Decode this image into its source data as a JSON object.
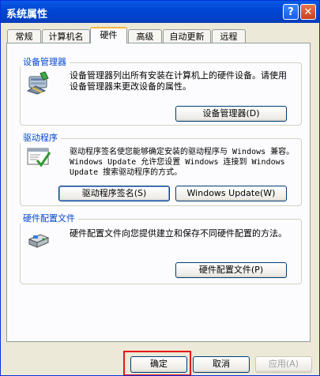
{
  "window": {
    "title": "系统属性",
    "help_glyph": "?",
    "close_glyph": "✕"
  },
  "tabs": [
    {
      "label": "常规"
    },
    {
      "label": "计算机名"
    },
    {
      "label": "硬件",
      "active": true
    },
    {
      "label": "高级"
    },
    {
      "label": "自动更新"
    },
    {
      "label": "远程"
    }
  ],
  "device_manager": {
    "legend": "设备管理器",
    "icon": "device-manager-icon",
    "description": "设备管理器列出所有安装在计算机上的硬件设备。请使用设备管理器来更改设备的属性。",
    "button": "设备管理器(D)"
  },
  "drivers": {
    "legend": "驱动程序",
    "icon": "driver-signing-icon",
    "description": "驱动程序签名使您能够确定安装的驱动程序与 Windows 兼容。Windows Update 允许您设置 Windows 连接到 Windows Update 搜索驱动程序的方式。",
    "signing_button": "驱动程序签名(S)",
    "update_button": "Windows Update(W)"
  },
  "hardware_profiles": {
    "legend": "硬件配置文件",
    "icon": "hardware-profile-icon",
    "description": "硬件配置文件向您提供建立和保存不同硬件配置的方法。",
    "button": "硬件配置文件(P)"
  },
  "footer": {
    "ok": "确定",
    "cancel": "取消",
    "apply": "应用(A)"
  },
  "colors": {
    "titlebar": "#0046d5",
    "legend_text": "#0046d5",
    "dialog_bg": "#ece9d8",
    "highlight": "#e51616"
  }
}
